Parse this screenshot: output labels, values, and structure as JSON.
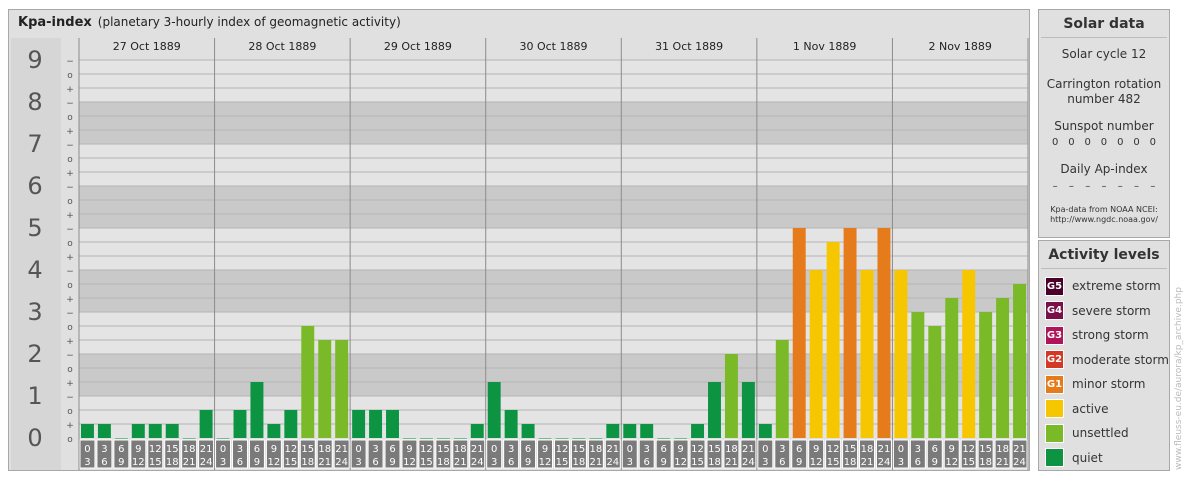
{
  "header": {
    "title": "Kpa-index",
    "subtitle": "(planetary 3-hourly index of geomagnetic activity)"
  },
  "chart_data": {
    "type": "bar",
    "ylim": [
      0,
      9
    ],
    "y_tick_labels": [
      "0",
      "1",
      "2",
      "3",
      "4",
      "5",
      "6",
      "7",
      "8",
      "9"
    ],
    "y_subtick_labels": [
      "+",
      "o",
      "−"
    ],
    "days": [
      "27 Oct 1889",
      "28 Oct 1889",
      "29 Oct 1889",
      "30 Oct 1889",
      "31 Oct 1889",
      "1 Nov 1889",
      "2 Nov 1889"
    ],
    "hour_ranges": [
      [
        "0",
        "3"
      ],
      [
        "3",
        "6"
      ],
      [
        "6",
        "9"
      ],
      [
        "9",
        "12"
      ],
      [
        "12",
        "15"
      ],
      [
        "15",
        "18"
      ],
      [
        "18",
        "21"
      ],
      [
        "21",
        "24"
      ]
    ],
    "values": [
      0.333,
      0.333,
      0,
      0.333,
      0.333,
      0.333,
      0,
      0.667,
      0,
      0.667,
      1.333,
      0.333,
      0.667,
      2.667,
      2.333,
      2.333,
      0.667,
      0.667,
      0.667,
      0,
      0,
      0,
      0,
      0.333,
      1.333,
      0.667,
      0.333,
      0,
      0,
      0,
      0,
      0.333,
      0.333,
      0.333,
      0,
      0,
      0.333,
      1.333,
      2,
      1.333,
      0.333,
      2.333,
      5,
      4,
      4.667,
      5,
      4,
      5,
      4,
      3,
      2.667,
      3.333,
      4,
      3,
      3.333,
      3.667
    ],
    "level_colors": {
      "quiet": "#0c9443",
      "unsettled": "#7ab928",
      "active": "#f6c700",
      "minor_storm": "#e67b1c",
      "moderate_storm": "#d23a25",
      "strong_storm": "#b0155a",
      "severe_storm": "#7a1048",
      "extreme_storm": "#4a0028"
    }
  },
  "solar_data": {
    "title": "Solar data",
    "solar_cycle": "Solar cycle 12",
    "carrington_line1": "Carrington rotation",
    "carrington_line2": "number 482",
    "sunspot_label": "Sunspot number",
    "sunspot_values": [
      "0",
      "0",
      "0",
      "0",
      "0",
      "0",
      "0"
    ],
    "ap_label": "Daily Ap-index",
    "ap_values": [
      "–",
      "–",
      "–",
      "–",
      "–",
      "–",
      "–"
    ],
    "source_line1": "Kpa-data from NOAA NCEI:",
    "source_line2": "http://www.ngdc.noaa.gov/"
  },
  "activity_levels": {
    "title": "Activity levels",
    "items": [
      {
        "code": "G5",
        "label": "extreme storm",
        "color": "#4a0028"
      },
      {
        "code": "G4",
        "label": "severe storm",
        "color": "#7a1048"
      },
      {
        "code": "G3",
        "label": "strong storm",
        "color": "#b0155a"
      },
      {
        "code": "G2",
        "label": "moderate storm",
        "color": "#d23a25"
      },
      {
        "code": "G1",
        "label": "minor storm",
        "color": "#e67b1c"
      },
      {
        "code": "",
        "label": "active",
        "color": "#f6c700"
      },
      {
        "code": "",
        "label": "unsettled",
        "color": "#7ab928"
      },
      {
        "code": "",
        "label": "quiet",
        "color": "#0c9443"
      }
    ]
  },
  "credit": "www.fleuss-eu.de/aurora/kp_archive.php"
}
